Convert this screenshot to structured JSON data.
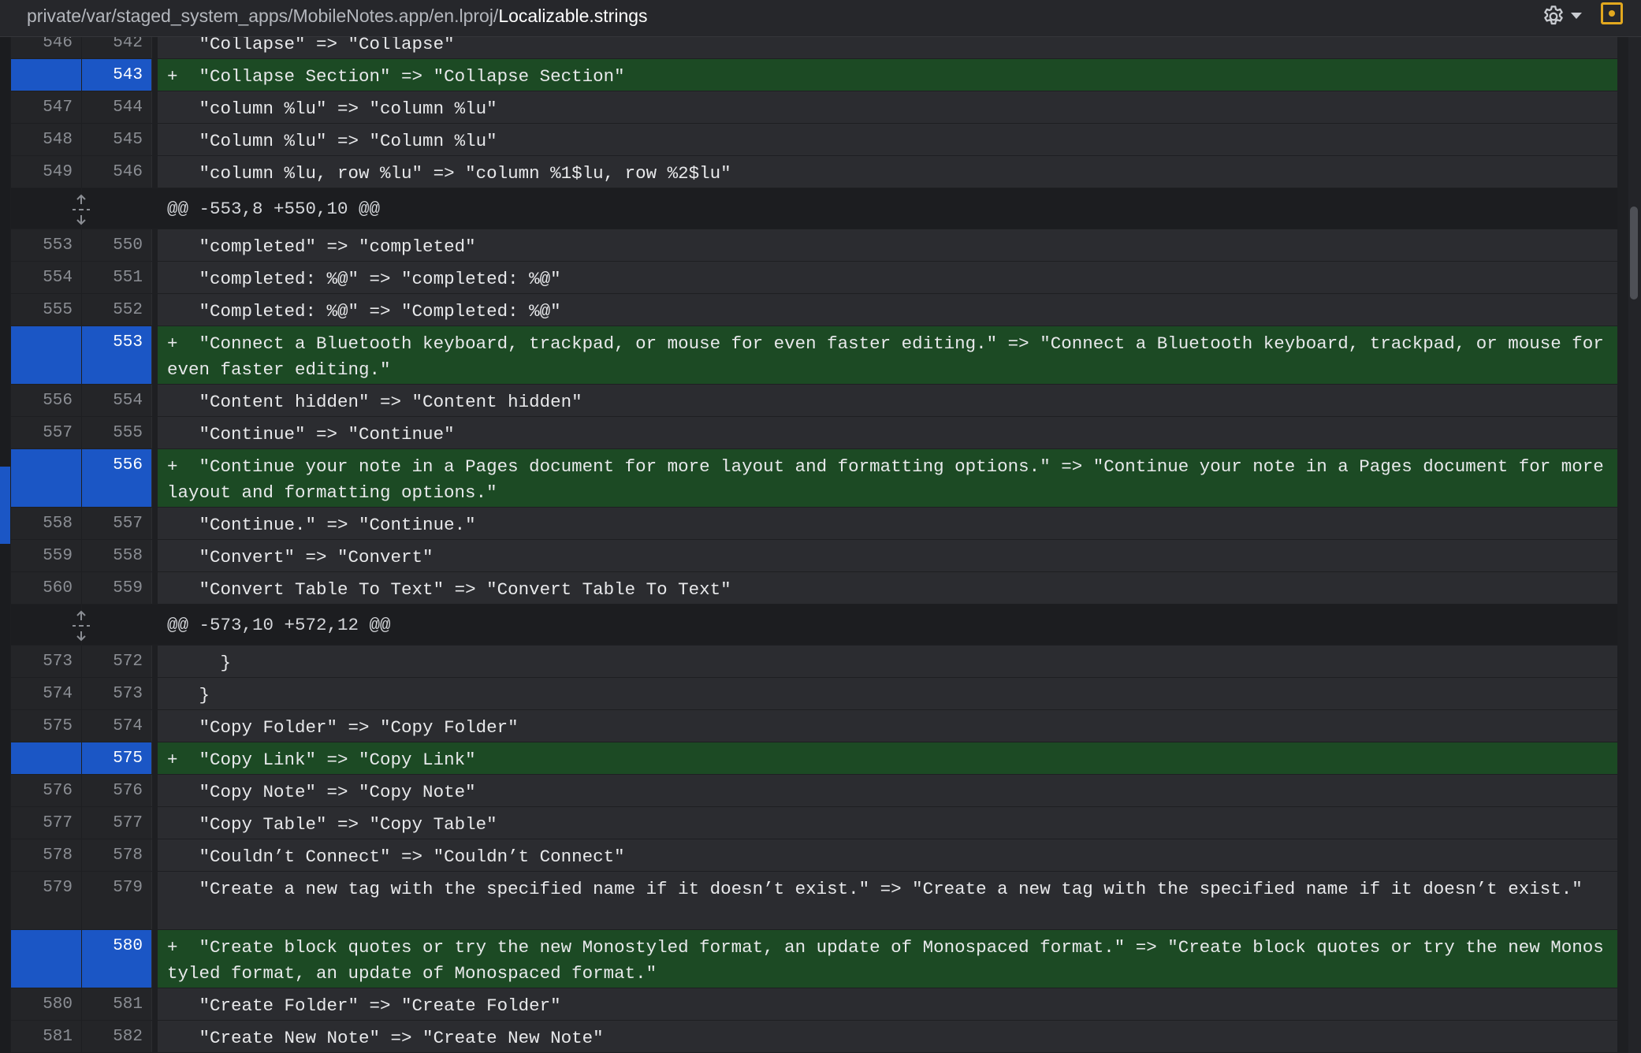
{
  "header": {
    "path_dir": "private/var/staged_system_apps/MobileNotes.app/en.lproj/",
    "file_name": "Localizable.strings",
    "settings_icon": "gear-icon",
    "settings_menu_icon": "chevron-down-icon",
    "record_icon": "square-dot-icon"
  },
  "colors": {
    "added_line_bg": "#1c4a24",
    "added_gutter_bg": "#1b56c5",
    "context_bg": "#2b2c30",
    "hunk_bg": "#1c1d20",
    "record_accent": "#e2a81f"
  },
  "diff": {
    "hunks": [
      {
        "header": "",
        "lines": [
          {
            "type": "context",
            "old": "546",
            "new": "542",
            "text": "\"Collapse\" => \"Collapse\""
          },
          {
            "type": "added",
            "old": "",
            "new": "543",
            "text": "\"Collapse Section\" => \"Collapse Section\""
          },
          {
            "type": "context",
            "old": "547",
            "new": "544",
            "text": "\"column %lu\" => \"column %lu\""
          },
          {
            "type": "context",
            "old": "548",
            "new": "545",
            "text": "\"Column %lu\" => \"Column %lu\""
          },
          {
            "type": "context",
            "old": "549",
            "new": "546",
            "text": "\"column %lu, row %lu\" => \"column %1$lu, row %2$lu\""
          }
        ]
      },
      {
        "header": "@@ -553,8 +550,10 @@",
        "lines": [
          {
            "type": "context",
            "old": "553",
            "new": "550",
            "text": "\"completed\" => \"completed\""
          },
          {
            "type": "context",
            "old": "554",
            "new": "551",
            "text": "\"completed: %@\" => \"completed: %@\""
          },
          {
            "type": "context",
            "old": "555",
            "new": "552",
            "text": "\"Completed: %@\" => \"Completed: %@\""
          },
          {
            "type": "added",
            "old": "",
            "new": "553",
            "text": "\"Connect a Bluetooth keyboard, trackpad, or mouse for even faster editing.\" => \"Connect a Bluetooth keyboard, trackpad, or mouse for even faster editing.\""
          },
          {
            "type": "context",
            "old": "556",
            "new": "554",
            "text": "\"Content hidden\" => \"Content hidden\""
          },
          {
            "type": "context",
            "old": "557",
            "new": "555",
            "text": "\"Continue\" => \"Continue\""
          },
          {
            "type": "added",
            "old": "",
            "new": "556",
            "text": "\"Continue your note in a Pages document for more layout and formatting options.\" => \"Continue your note in a Pages document for more layout and formatting options.\""
          },
          {
            "type": "context",
            "old": "558",
            "new": "557",
            "text": "\"Continue.\" => \"Continue.\""
          },
          {
            "type": "context",
            "old": "559",
            "new": "558",
            "text": "\"Convert\" => \"Convert\""
          },
          {
            "type": "context",
            "old": "560",
            "new": "559",
            "text": "\"Convert Table To Text\" => \"Convert Table To Text\""
          }
        ]
      },
      {
        "header": "@@ -573,10 +572,12 @@",
        "lines": [
          {
            "type": "context",
            "old": "573",
            "new": "572",
            "text": "  }"
          },
          {
            "type": "context",
            "old": "574",
            "new": "573",
            "text": "}"
          },
          {
            "type": "context",
            "old": "575",
            "new": "574",
            "text": "\"Copy Folder\" => \"Copy Folder\""
          },
          {
            "type": "added",
            "old": "",
            "new": "575",
            "text": "\"Copy Link\" => \"Copy Link\""
          },
          {
            "type": "context",
            "old": "576",
            "new": "576",
            "text": "\"Copy Note\" => \"Copy Note\""
          },
          {
            "type": "context",
            "old": "577",
            "new": "577",
            "text": "\"Copy Table\" => \"Copy Table\""
          },
          {
            "type": "context",
            "old": "578",
            "new": "578",
            "text": "\"Couldn’t Connect\" => \"Couldn’t Connect\""
          },
          {
            "type": "context",
            "old": "579",
            "new": "579",
            "text": "\"Create a new tag with the specified name if it doesn’t exist.\" => \"Create a new tag with the specified name if it doesn’t exist.\""
          },
          {
            "type": "added",
            "old": "",
            "new": "580",
            "text": "\"Create block quotes or try the new Monostyled format, an update of Monospaced format.\" => \"Create block quotes or try the new Monostyled format, an update of Monospaced format.\""
          },
          {
            "type": "context",
            "old": "580",
            "new": "581",
            "text": "\"Create Folder\" => \"Create Folder\""
          },
          {
            "type": "context",
            "old": "581",
            "new": "582",
            "text": "\"Create New Note\" => \"Create New Note\""
          }
        ]
      }
    ]
  }
}
